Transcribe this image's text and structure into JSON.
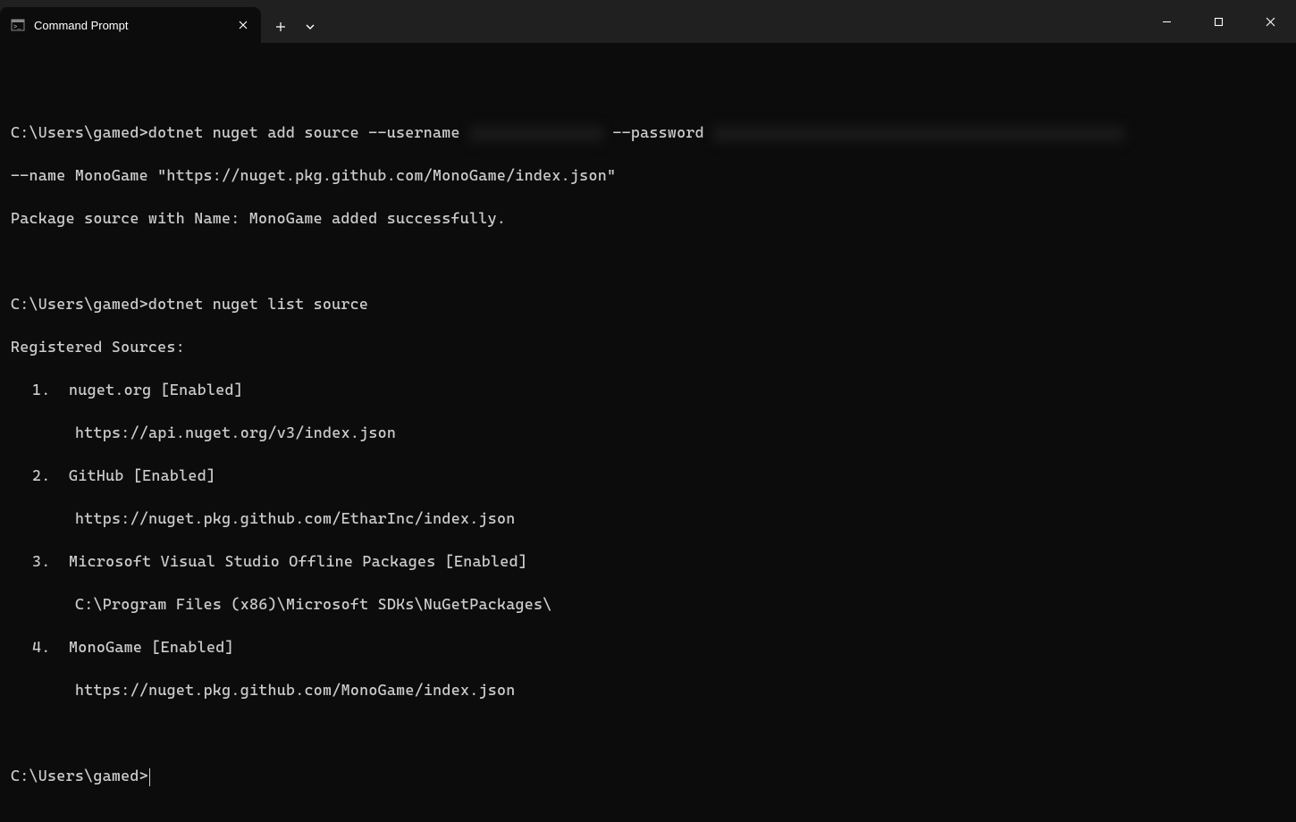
{
  "titlebar": {
    "tab_title": "Command Prompt"
  },
  "prompt": "C:\\Users\\gamed>",
  "cmd1": {
    "part1": "dotnet nuget add source --username ",
    "part2": " --password ",
    "part3": "",
    "line2": "--name MonoGame \"https://nuget.pkg.github.com/MonoGame/index.json\""
  },
  "output1": "Package source with Name: MonoGame added successfully.",
  "cmd2": "dotnet nuget list source",
  "output2": {
    "header": "Registered Sources:",
    "sources": [
      {
        "num_name_status": "1.  nuget.org [Enabled]",
        "location": "https://api.nuget.org/v3/index.json"
      },
      {
        "num_name_status": "2.  GitHub [Enabled]",
        "location": "https://nuget.pkg.github.com/EtharInc/index.json"
      },
      {
        "num_name_status": "3.  Microsoft Visual Studio Offline Packages [Enabled]",
        "location": "C:\\Program Files (x86)\\Microsoft SDKs\\NuGetPackages\\"
      },
      {
        "num_name_status": "4.  MonoGame [Enabled]",
        "location": "https://nuget.pkg.github.com/MonoGame/index.json"
      }
    ]
  }
}
